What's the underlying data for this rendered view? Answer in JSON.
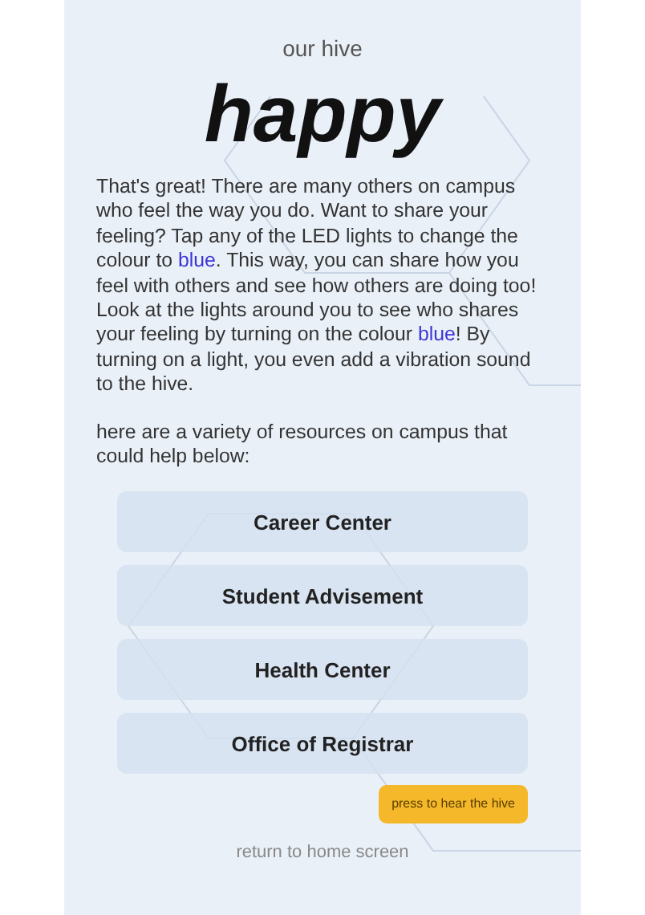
{
  "header": {
    "subtitle": "our hive",
    "mood": "happy"
  },
  "message": [
    {
      "text": "That's great! There are many others on campus who feel the way you do. Want to share your feeling? Tap any of the LED lights to change the colour to ",
      "highlight": false
    },
    {
      "text": "blue",
      "highlight": true
    },
    {
      "text": ". This way, you can share how you feel with others and see how others are doing too! Look at the lights around you to see who shares your feeling by turning on the colour ",
      "highlight": false
    },
    {
      "text": "blue",
      "highlight": true
    },
    {
      "text": "! By turning on a light, you even add a vibration sound to the hive.",
      "highlight": false
    }
  ],
  "resources_intro": "here are a variety of resources on campus that could help below:",
  "resources": [
    "Career Center",
    "Student Advisement",
    "Health Center",
    "Office of Registrar"
  ],
  "hive_button": "press to hear the hive",
  "home_link": "return to home screen"
}
